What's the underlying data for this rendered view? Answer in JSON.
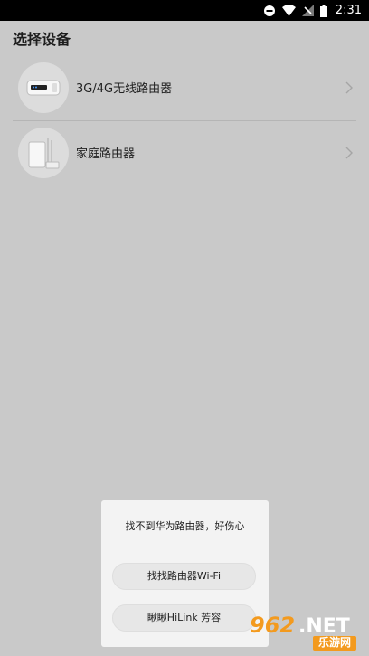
{
  "status_bar": {
    "time": "2:31",
    "icons": [
      "do-not-disturb-icon",
      "wifi-icon",
      "no-signal-icon",
      "battery-icon"
    ]
  },
  "page": {
    "title": "选择设备"
  },
  "devices": [
    {
      "label": "3G/4G无线路由器",
      "icon": "mobile-wifi-router-image"
    },
    {
      "label": "家庭路由器",
      "icon": "home-router-image"
    }
  ],
  "dialog": {
    "message": "找不到华为路由器，好伤心",
    "buttons": [
      {
        "label": "找找路由器Wi-Fi"
      },
      {
        "label": "瞅瞅HiLink 芳容"
      }
    ]
  },
  "watermark": {
    "logo_text": "962.NET",
    "subtext": "乐游网"
  },
  "colors": {
    "overlay_bg": "#c9c9c9",
    "dialog_bg": "#f3f3f3",
    "status_bar_bg": "#000000",
    "watermark_orange": "#f39a1e"
  }
}
